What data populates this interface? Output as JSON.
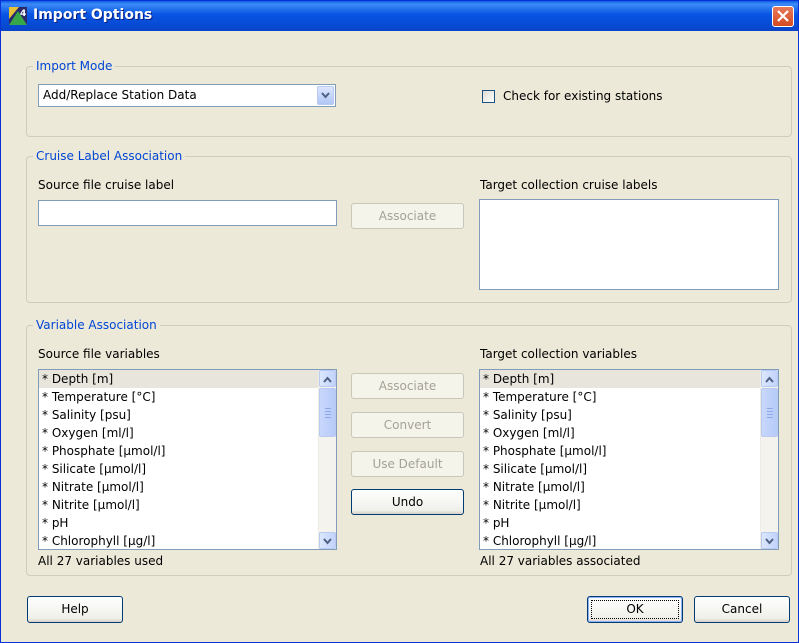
{
  "window": {
    "title": "Import Options"
  },
  "import_mode": {
    "legend": "Import Mode",
    "mode_selected": "Add/Replace Station Data",
    "check_existing_label": "Check for existing stations",
    "check_existing_checked": false
  },
  "cruise": {
    "legend": "Cruise Label Association",
    "source_label": "Source file cruise label",
    "source_value": "",
    "associate_label": "Associate",
    "target_label": "Target collection cruise labels"
  },
  "variables": {
    "legend": "Variable Association",
    "source_label": "Source file variables",
    "target_label": "Target collection variables",
    "source_items": [
      "* Depth [m]",
      "* Temperature [°C]",
      "* Salinity [psu]",
      "* Oxygen [ml/l]",
      "* Phosphate [µmol/l]",
      "* Silicate [µmol/l]",
      "* Nitrate [µmol/l]",
      "* Nitrite [µmol/l]",
      "* pH",
      "* Chlorophyll [µg/l]"
    ],
    "target_items": [
      "* Depth [m]",
      "* Temperature [°C]",
      "* Salinity [psu]",
      "* Oxygen [ml/l]",
      "* Phosphate [µmol/l]",
      "* Silicate [µmol/l]",
      "* Nitrate [µmol/l]",
      "* Nitrite [µmol/l]",
      "* pH",
      "* Chlorophyll [µg/l]"
    ],
    "associate_label": "Associate",
    "convert_label": "Convert",
    "use_default_label": "Use Default",
    "undo_label": "Undo",
    "source_status": "All 27 variables used",
    "target_status": "All 27 variables associated"
  },
  "footer": {
    "help_label": "Help",
    "ok_label": "OK",
    "cancel_label": "Cancel"
  },
  "colors": {
    "title_bar": "#0854e3",
    "legend_text": "#0046d5",
    "dialog_bg": "#ece9d8",
    "close_button": "#d44a21"
  }
}
